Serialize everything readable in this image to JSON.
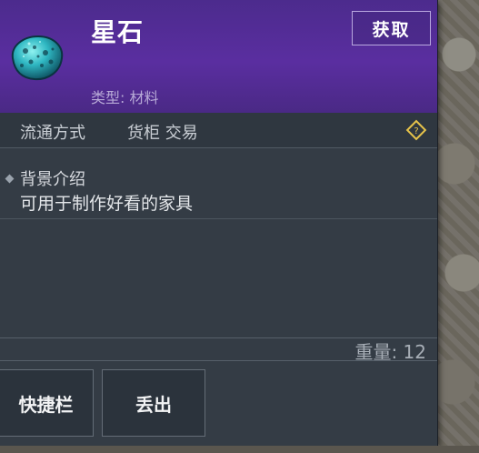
{
  "item": {
    "name": "星石",
    "type_label": "类型: 材料",
    "icon": "star-stone-icon"
  },
  "acquire_label": "获取",
  "trade": {
    "label": "流通方式",
    "values": "货柜 交易",
    "help_icon": "help-diamond-icon"
  },
  "description": {
    "heading": "背景介绍",
    "text": "可用于制作好看的家具"
  },
  "weight": "重量: 12",
  "buttons": {
    "hotbar_label": "快捷栏",
    "drop_label": "丢出"
  },
  "colors": {
    "header_purple": "#5a2ea0",
    "panel": "#343c45",
    "accent_gold": "#e6c34a"
  }
}
